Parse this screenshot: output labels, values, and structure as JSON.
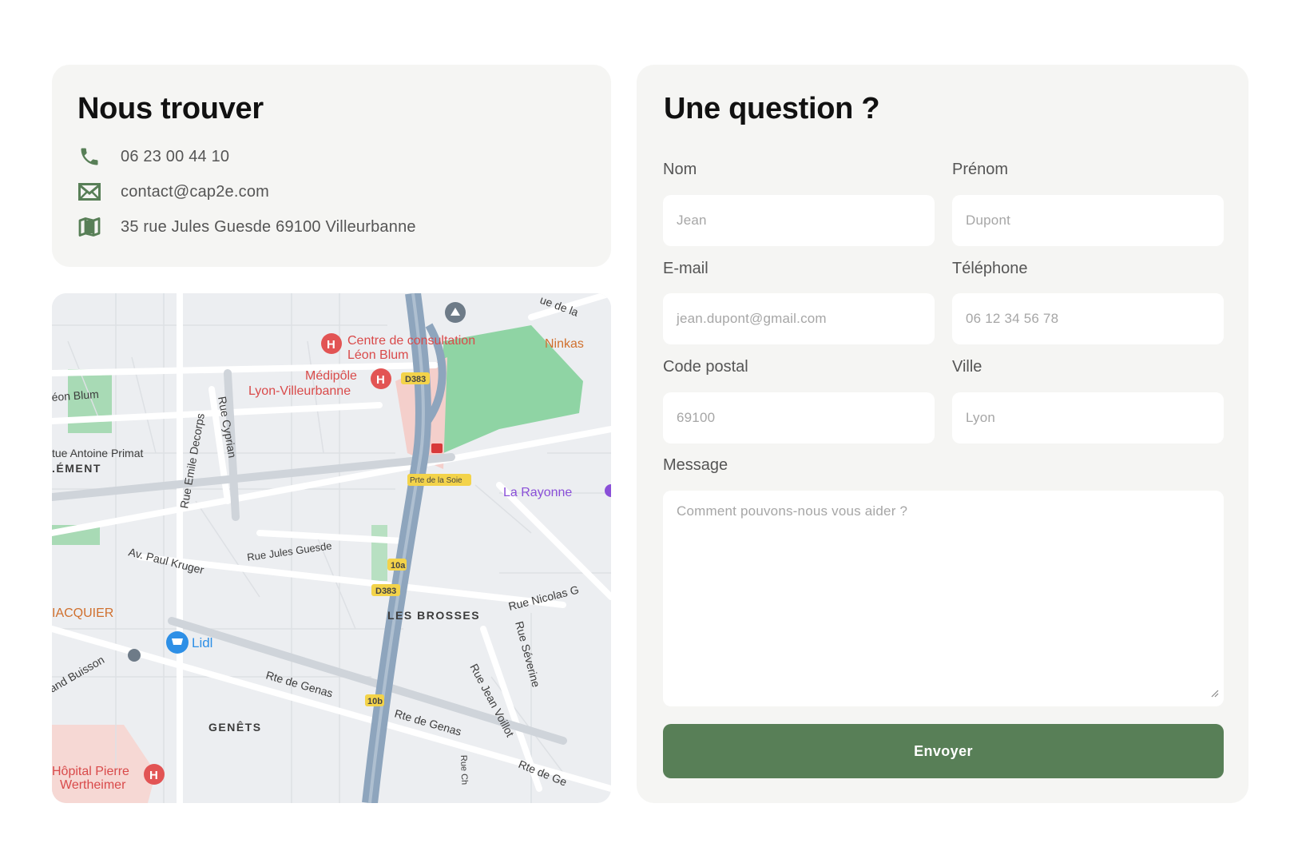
{
  "contact": {
    "title": "Nous trouver",
    "phone": "06 23 00 44 10",
    "email": "contact@cap2e.com",
    "address": "35 rue Jules Guesde 69100 Villeurbanne",
    "icons": [
      "phone-icon",
      "mail-icon",
      "map-icon"
    ],
    "accent_color": "#587f57"
  },
  "map": {
    "labels": {
      "centre_1": "Centre de consultation",
      "centre_2": "Léon Blum",
      "medipole_1": "Médipôle",
      "medipole_2": "Lyon-Villeurbanne",
      "ninkas": "Ninkas",
      "leon_blum": "éon Blum",
      "antoine_primat": "tue Antoine Primat",
      "clement": ".ÉMENT",
      "emile_decorps": "Rue Emile Decorps",
      "cyprian": "Rue Cyprian",
      "d383_a": "D383",
      "d383_b": "D383",
      "porte_soie": "Prte de la Soie",
      "la_rayonne": "La Rayonne",
      "jules_guesde": "Rue Jules Guesde",
      "paul_kruger": "Av. Paul Kruger",
      "r10a": "10a",
      "r10b": "10b",
      "jacquier": "IACQUIER",
      "les_brosses": "LES BROSSES",
      "nicolas": "Rue Nicolas G",
      "severine": "Rue Séverine",
      "jean_voillot": "Rue Jean Voillot",
      "lidl": "Lidl",
      "buisson": "and Buisson",
      "genas_1": "Rte de Genas",
      "genas_2": "Rte de Genas",
      "genas_3": "Rte de Ge",
      "genets": "GENÊTS",
      "rue_ch": "Rue Ch",
      "hopital_1": "Hôpital Pierre",
      "hopital_2": "Wertheimer",
      "rue_de_la": "ue de la"
    }
  },
  "form": {
    "title": "Une question ?",
    "fields": {
      "nom": {
        "label": "Nom",
        "placeholder": "Jean"
      },
      "prenom": {
        "label": "Prénom",
        "placeholder": "Dupont"
      },
      "email": {
        "label": "E-mail",
        "placeholder": "jean.dupont@gmail.com"
      },
      "telephone": {
        "label": "Téléphone",
        "placeholder": "06 12 34 56 78"
      },
      "code_postal": {
        "label": "Code postal",
        "placeholder": "69100"
      },
      "ville": {
        "label": "Ville",
        "placeholder": "Lyon"
      },
      "message": {
        "label": "Message",
        "placeholder": "Comment pouvons-nous vous aider ?"
      }
    },
    "submit_label": "Envoyer",
    "button_color": "#587f57"
  }
}
